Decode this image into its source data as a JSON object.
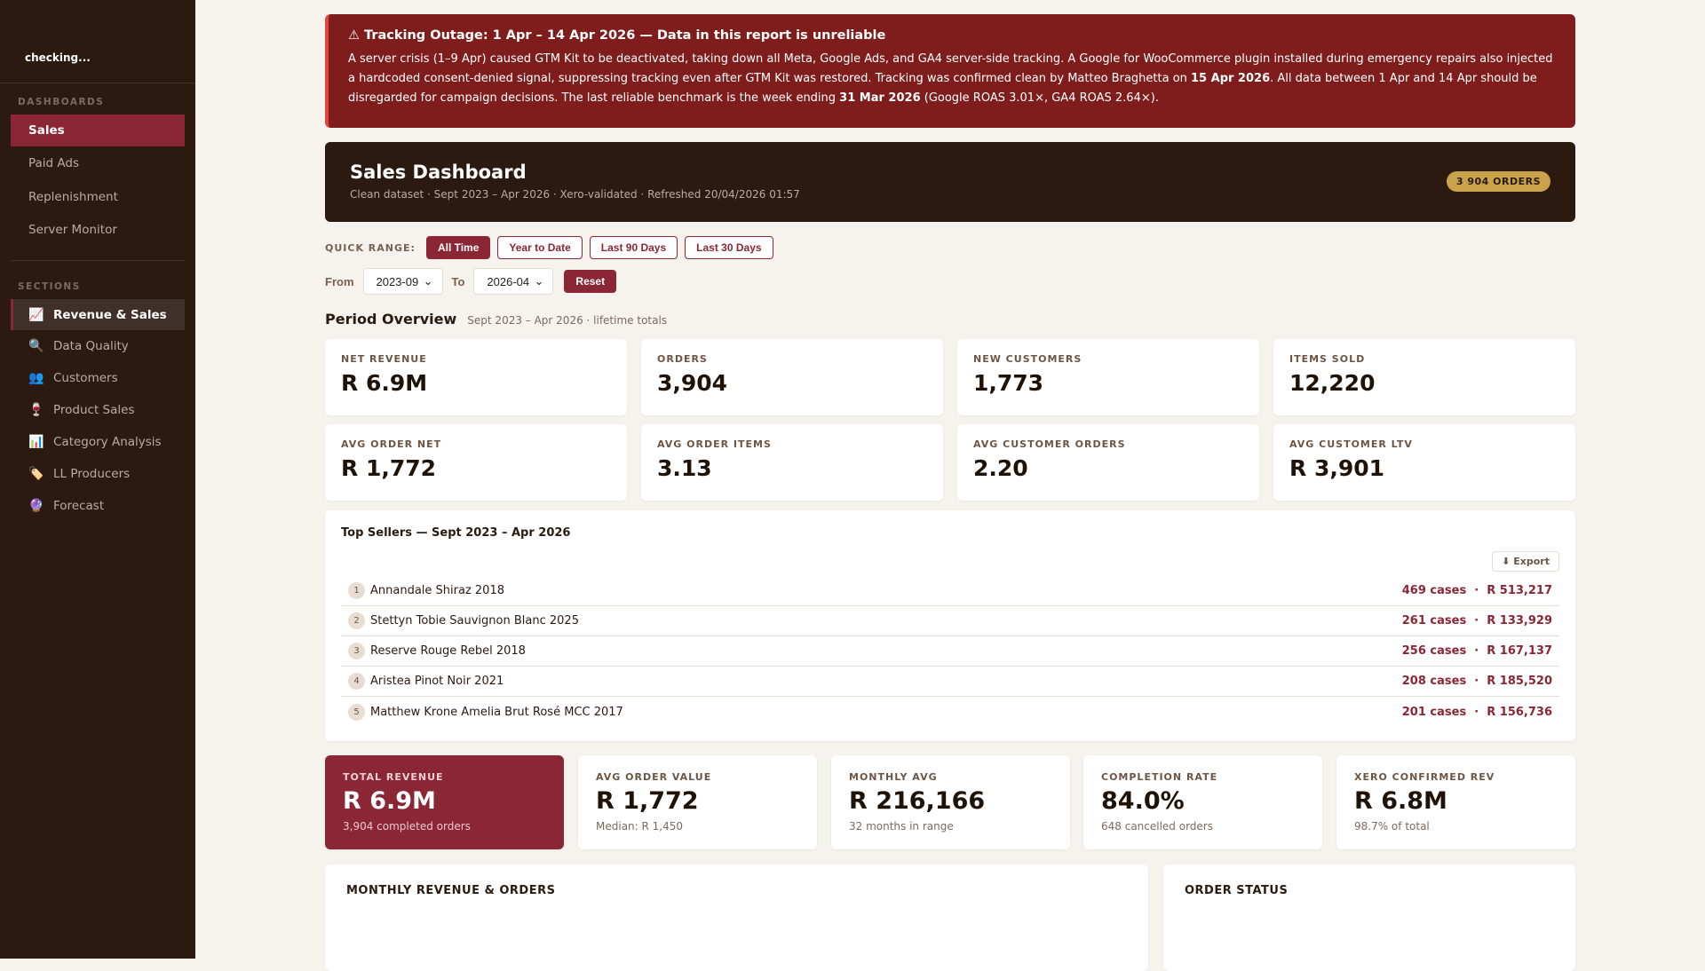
{
  "sidebar": {
    "status": "checking...",
    "dashboards_label": "DASHBOARDS",
    "dashboards": [
      {
        "label": "Sales"
      },
      {
        "label": "Paid Ads"
      },
      {
        "label": "Replenishment"
      },
      {
        "label": "Server Monitor"
      }
    ],
    "sections_label": "SECTIONS",
    "sections": [
      {
        "icon": "📈",
        "label": "Revenue & Sales"
      },
      {
        "icon": "🔍",
        "label": "Data Quality"
      },
      {
        "icon": "👥",
        "label": "Customers"
      },
      {
        "icon": "🍷",
        "label": "Product Sales"
      },
      {
        "icon": "📊",
        "label": "Category Analysis"
      },
      {
        "icon": "🏷️",
        "label": "LL Producers"
      },
      {
        "icon": "🔮",
        "label": "Forecast"
      }
    ]
  },
  "alert": {
    "title": "⚠ Tracking Outage: 1 Apr – 14 Apr 2026 — Data in this report is unreliable",
    "p1": "A server crisis (1–9 Apr) caused GTM Kit to be deactivated, taking down all Meta, Google Ads, and GA4 server-side tracking. A Google for WooCommerce plugin installed during emergency repairs also injected a hardcoded consent-denied signal, suppressing tracking even after GTM Kit was restored. Tracking was confirmed clean by Matteo Braghetta on ",
    "b1": "15 Apr 2026",
    "p2": ". All data between 1 Apr and 14 Apr should be disregarded for campaign decisions. The last reliable benchmark is the week ending ",
    "b2": "31 Mar 2026",
    "p3": " (Google ROAS 3.01×, GA4 ROAS 2.64×)."
  },
  "header": {
    "title": "Sales Dashboard",
    "subtitle": "Clean dataset · Sept 2023 – Apr 2026 · Xero-validated · Refreshed 20/04/2026 01:57",
    "badge": "3 904 ORDERS"
  },
  "quick_range": {
    "label": "QUICK RANGE:",
    "options": [
      "All Time",
      "Year to Date",
      "Last 90 Days",
      "Last 30 Days"
    ]
  },
  "filters": {
    "from_label": "From",
    "from": "2023-09",
    "to_label": "To",
    "to": "2026-04",
    "reset": "Reset"
  },
  "overview": {
    "title": "Period Overview",
    "subtitle": "Sept 2023 – Apr 2026 · lifetime totals",
    "kpis": [
      {
        "label": "NET REVENUE",
        "value": "R 6.9M"
      },
      {
        "label": "ORDERS",
        "value": "3,904"
      },
      {
        "label": "NEW CUSTOMERS",
        "value": "1,773"
      },
      {
        "label": "ITEMS SOLD",
        "value": "12,220"
      },
      {
        "label": "AVG ORDER NET",
        "value": "R 1,772"
      },
      {
        "label": "AVG ORDER ITEMS",
        "value": "3.13"
      },
      {
        "label": "AVG CUSTOMER ORDERS",
        "value": "2.20"
      },
      {
        "label": "AVG CUSTOMER LTV",
        "value": "R 3,901"
      }
    ]
  },
  "top_sellers": {
    "title": "Top Sellers — Sept 2023 – Apr 2026",
    "export": "⬇ Export",
    "items": [
      {
        "rank": "1",
        "name": "Annandale Shiraz 2018",
        "stats": "469 cases  ·  R 513,217"
      },
      {
        "rank": "2",
        "name": "Stettyn Tobie Sauvignon Blanc 2025",
        "stats": "261 cases  ·  R 133,929"
      },
      {
        "rank": "3",
        "name": "Reserve Rouge Rebel 2018",
        "stats": "256 cases  ·  R 167,137"
      },
      {
        "rank": "4",
        "name": "Aristea Pinot Noir 2021",
        "stats": "208 cases  ·  R 185,520"
      },
      {
        "rank": "5",
        "name": "Matthew Krone Amelia Brut Rosé MCC 2017",
        "stats": "201 cases  ·  R 156,736"
      }
    ]
  },
  "summary": [
    {
      "label": "TOTAL REVENUE",
      "value": "R 6.9M",
      "sub": "3,904 completed orders"
    },
    {
      "label": "AVG ORDER VALUE",
      "value": "R 1,772",
      "sub": "Median: R 1,450"
    },
    {
      "label": "MONTHLY AVG",
      "value": "R 216,166",
      "sub": "32 months in range"
    },
    {
      "label": "COMPLETION RATE",
      "value": "84.0%",
      "sub": "648 cancelled orders"
    },
    {
      "label": "XERO CONFIRMED REV",
      "value": "R 6.8M",
      "sub": "98.7% of total"
    }
  ],
  "panels": {
    "monthly": "MONTHLY REVENUE & ORDERS",
    "status": "ORDER STATUS"
  }
}
